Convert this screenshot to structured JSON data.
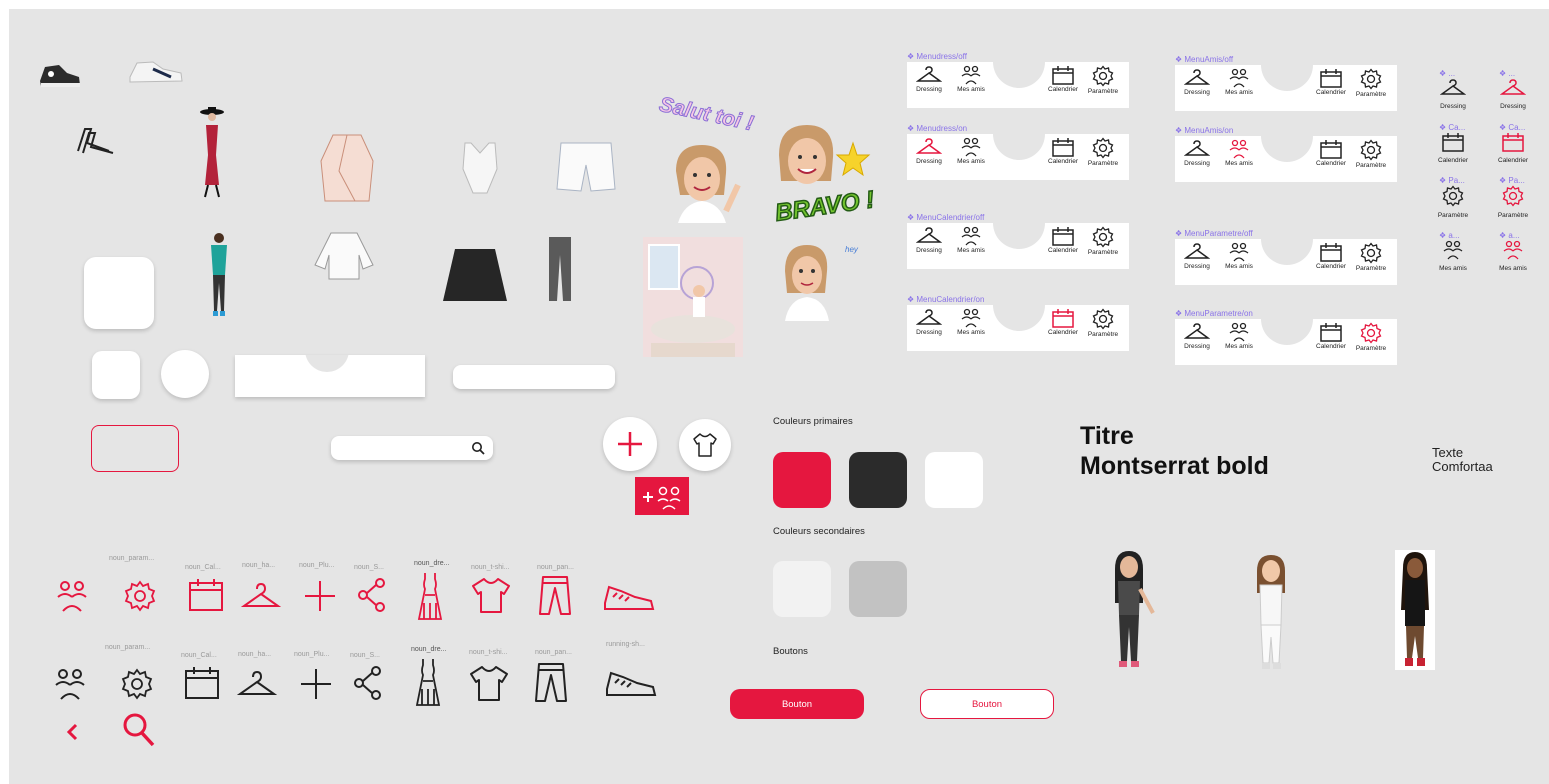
{
  "colors": {
    "primary_red": "#e5173f",
    "dark": "#2b2b2b",
    "white": "#ffffff",
    "light_grey": "#f2f2f2",
    "mid_grey": "#c2c2c2",
    "canvas": "#e5e5e5",
    "label_purple": "#8a73e8"
  },
  "stickers": {
    "salut": "Salut toi !",
    "bravo": "BRAVO !",
    "hey": "hey"
  },
  "menus": [
    {
      "variant": "Menudress/off",
      "active": null
    },
    {
      "variant": "Menudress/on",
      "active": "dressing"
    },
    {
      "variant": "MenuCalendrier/off",
      "active": null
    },
    {
      "variant": "MenuCalendrier/on",
      "active": "calendrier"
    },
    {
      "variant": "MenuAmis/off",
      "active": null
    },
    {
      "variant": "MenuAmis/on",
      "active": "amis"
    },
    {
      "variant": "MenuParametre/off",
      "active": null
    },
    {
      "variant": "MenuParametre/on",
      "active": "parametre"
    }
  ],
  "menu_items": {
    "dressing": "Dressing",
    "amis": "Mes amis",
    "calendrier": "Calendrier",
    "parametre": "Paramètre"
  },
  "side_icons": {
    "labels_off": [
      "❖ ...",
      "❖ Ca...",
      "❖ Pa...",
      "❖ a..."
    ],
    "labels_on": [
      "❖ ...",
      "❖ Ca...",
      "❖ Pa...",
      "❖ a..."
    ],
    "items": [
      "Dressing",
      "Calendrier",
      "Paramètre",
      "Mes amis"
    ]
  },
  "icon_labels": {
    "row1": [
      "noun_param...",
      "noun_Cal...",
      "noun_ha...",
      "noun_Plu...",
      "noun_S...",
      "noun_dre...",
      "noun_t-shi...",
      "noun_pan..."
    ],
    "row2": [
      "noun_param...",
      "noun_Cal...",
      "noun_ha...",
      "noun_Plu...",
      "noun_S...",
      "noun_dre...",
      "noun_t-shi...",
      "noun_pan...",
      "running-sh..."
    ]
  },
  "palette": {
    "primary_title": "Couleurs primaires",
    "secondary_title": "Couleurs secondaires",
    "buttons_title": "Boutons"
  },
  "buttons": {
    "filled": "Bouton",
    "outline": "Bouton"
  },
  "typography": {
    "title_line1": "Titre",
    "title_line2": "Montserrat bold",
    "text_line1": "Texte",
    "text_line2": "Comfortaa"
  }
}
